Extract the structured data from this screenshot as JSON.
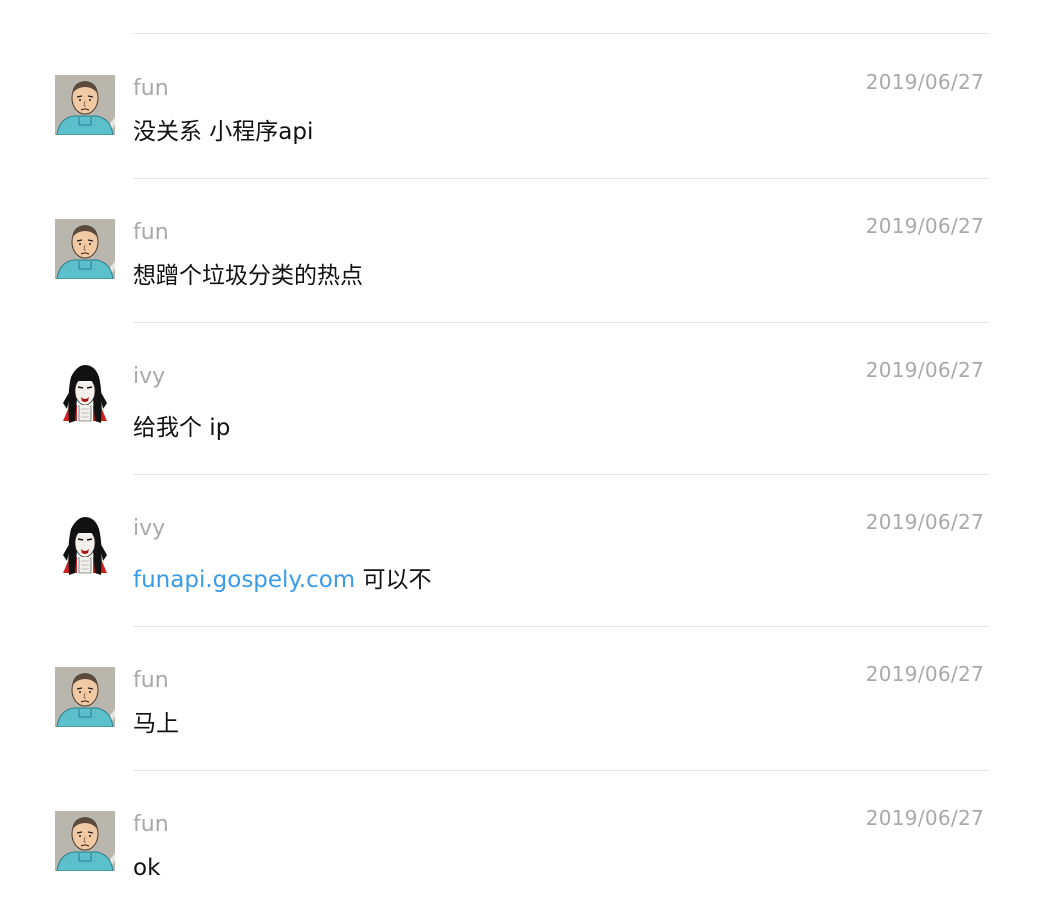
{
  "comments": [
    {
      "author": "fun",
      "avatar": "fun-avatar",
      "date": "2019/06/27",
      "text": "没关系 小程序api"
    },
    {
      "author": "fun",
      "avatar": "fun-avatar",
      "date": "2019/06/27",
      "text": "想蹭个垃圾分类的热点"
    },
    {
      "author": "ivy",
      "avatar": "ivy-avatar",
      "date": "2019/06/27",
      "text": "给我个 ip"
    },
    {
      "author": "ivy",
      "avatar": "ivy-avatar",
      "date": "2019/06/27",
      "link": "funapi.gospely.com",
      "text": " 可以不"
    },
    {
      "author": "fun",
      "avatar": "fun-avatar",
      "date": "2019/06/27",
      "text": "马上"
    },
    {
      "author": "fun",
      "avatar": "fun-avatar",
      "date": "2019/06/27",
      "text": "ok"
    }
  ],
  "colors": {
    "meta_gray": "#a9a9a9",
    "link_blue": "#3a9be8",
    "divider": "#e5e5e5",
    "fun_avatar_shirt": "#5bbfcc",
    "ivy_avatar_hair": "#111111",
    "ivy_avatar_collar": "#cc2222"
  }
}
